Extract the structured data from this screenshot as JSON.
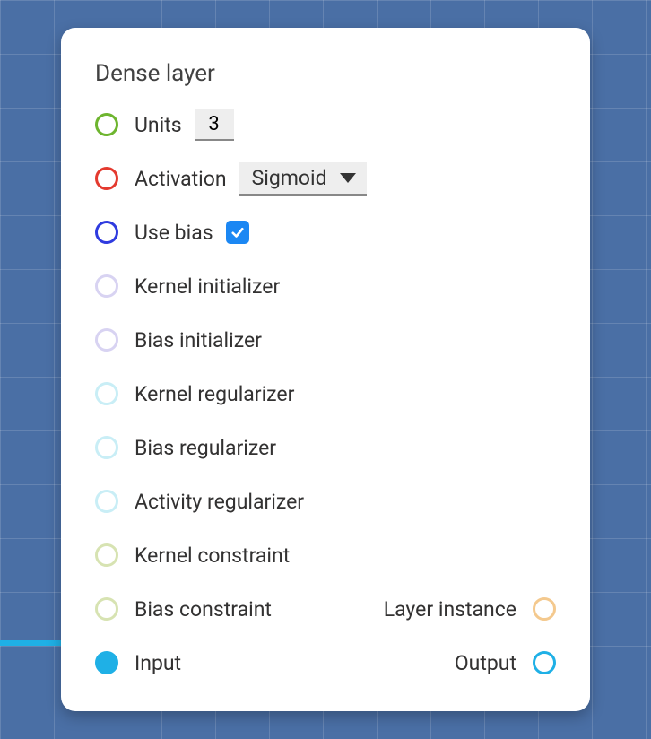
{
  "title": "Dense layer",
  "colors": {
    "green": "#6eb52f",
    "red": "#e43a2f",
    "indigo": "#2f3bdf",
    "lavender": "#d8d3f2",
    "lightblue": "#c9eef6",
    "lightgreen": "#d7e3b2",
    "orange": "#f4c98e",
    "cyan": "#1fb0e6"
  },
  "rows": {
    "units": {
      "label": "Units",
      "value": "3"
    },
    "activation": {
      "label": "Activation",
      "value": "Sigmoid"
    },
    "use_bias": {
      "label": "Use bias",
      "checked": true
    },
    "kernel_init": {
      "label": "Kernel initializer"
    },
    "bias_init": {
      "label": "Bias initializer"
    },
    "kernel_reg": {
      "label": "Kernel regularizer"
    },
    "bias_reg": {
      "label": "Bias regularizer"
    },
    "activity_reg": {
      "label": "Activity regularizer"
    },
    "kernel_const": {
      "label": "Kernel constraint"
    },
    "bias_const": {
      "label": "Bias constraint"
    },
    "layer_instance": {
      "label": "Layer instance"
    },
    "input": {
      "label": "Input"
    },
    "output": {
      "label": "Output"
    }
  }
}
